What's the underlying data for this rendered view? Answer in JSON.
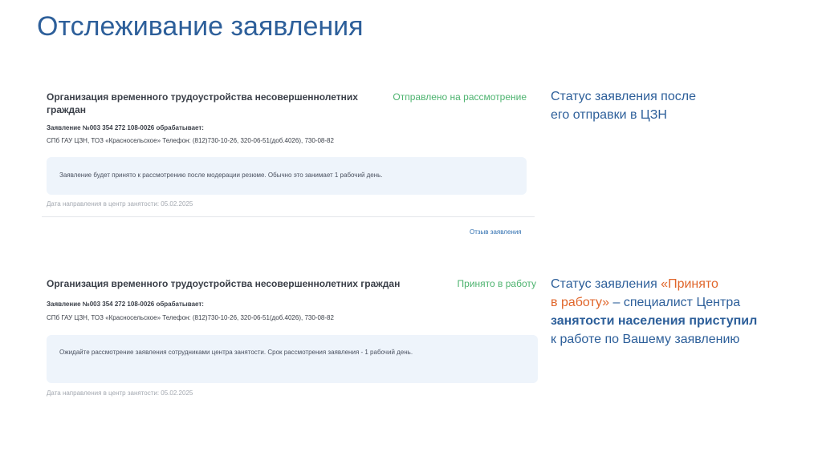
{
  "title": "Отслеживание заявления",
  "card1": {
    "title": "Организация временного трудоустройства несовершеннолетних граждан",
    "status": "Отправлено на рассмотрение",
    "application_number": "Заявление №003 354 272 108-0026 обрабатывает:",
    "organization": "СПб ГАУ ЦЗН, ТОЗ «Красносельское» Телефон: (812)730-10-26, 320-06-51(доб.4026), 730-08-82",
    "note": "Заявление будет принято к рассмотрению после модерации резюме. Обычно это занимает 1 рабочий день.",
    "date": "Дата направления в центр занятости: 05.02.2025",
    "withdraw_link": "Отзыв заявления"
  },
  "card2": {
    "title": "Организация временного трудоустройства несовершеннолетних граждан",
    "status": "Принято в работу",
    "application_number": "Заявление №003 354 272 108-0026 обрабатывает:",
    "organization": "СПб ГАУ ЦЗН, ТОЗ «Красносельское» Телефон: (812)730-10-26, 320-06-51(доб.4026), 730-08-82",
    "note": "Ожидайте рассмотрение заявления сотрудниками центра занятости. Срок рассмотрения заявления - 1 рабочий день.",
    "date": "Дата направления в центр занятости: 05.02.2025"
  },
  "side1": {
    "line1": "Статус заявления после",
    "line2": "его отправки в ЦЗН"
  },
  "side2": {
    "prefix": "Статус заявления ",
    "accent1": "«Принято",
    "accent2": "в работу»",
    "mid": " – специалист Центра",
    "bold": "занятости населения приступил",
    "end": "к работе по Вашему заявлению"
  },
  "colors": {
    "title": "#2d5f9a",
    "status_green": "#4db36f",
    "accent_orange": "#e0662b",
    "note_bg": "#eef4fb",
    "link": "#2f6fb0"
  }
}
